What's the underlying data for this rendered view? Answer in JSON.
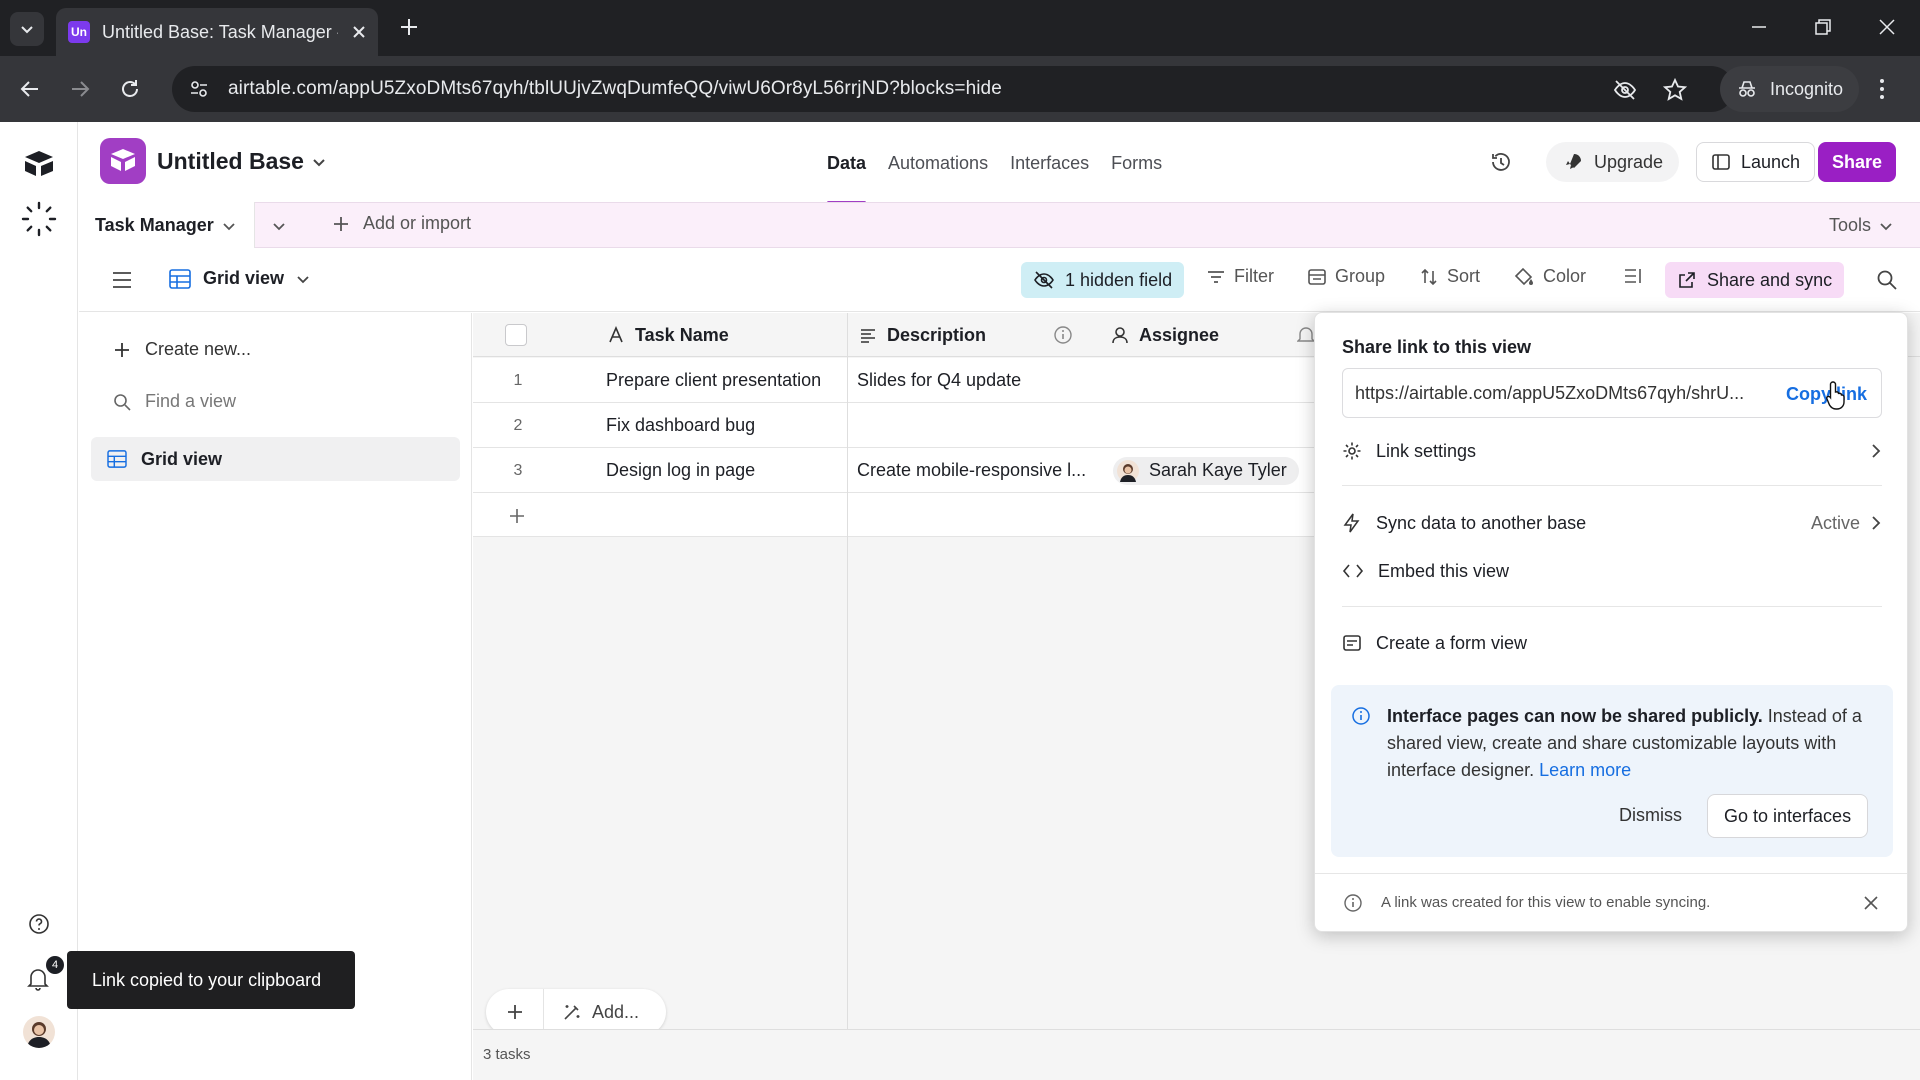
{
  "browser": {
    "tab_title": "Untitled Base: Task Manager - A",
    "tab_favicon": "Un",
    "url": "airtable.com/appU5ZxoDMts67qyh/tblUUjvZwqDumfeQQ/viwU6Or8yL56rrjND?blocks=hide",
    "incognito_label": "Incognito"
  },
  "base": {
    "title": "Untitled Base",
    "tabs": [
      "Data",
      "Automations",
      "Interfaces",
      "Forms"
    ],
    "active_tab": "Data",
    "upgrade_label": "Upgrade",
    "launch_label": "Launch",
    "share_label": "Share"
  },
  "tablebar": {
    "table_name": "Task Manager",
    "add_import": "Add or import",
    "tools": "Tools"
  },
  "viewbar": {
    "view_name": "Grid view",
    "hidden_field": "1 hidden field",
    "filter": "Filter",
    "group": "Group",
    "sort": "Sort",
    "color": "Color",
    "share_sync": "Share and sync"
  },
  "sidebar": {
    "create_new": "Create new...",
    "find_view": "Find a view",
    "views": [
      "Grid view"
    ]
  },
  "grid": {
    "columns": [
      "Task Name",
      "Description",
      "Assignee"
    ],
    "rows": [
      {
        "num": "1",
        "task": "Prepare client presentation",
        "description": "Slides for Q4 update",
        "assignee": ""
      },
      {
        "num": "2",
        "task": "Fix dashboard bug",
        "description": "",
        "assignee": ""
      },
      {
        "num": "3",
        "task": "Design log in page",
        "description": "Create mobile-responsive l...",
        "assignee": "Sarah Kaye Tyler"
      }
    ],
    "add_label": "Add...",
    "record_count": "3 tasks"
  },
  "share_popover": {
    "title": "Share link to this view",
    "link_url": "https://airtable.com/appU5ZxoDMts67qyh/shrU...",
    "copy_link": "Copy link",
    "link_settings": "Link settings",
    "sync_label": "Sync data to another base",
    "sync_status": "Active",
    "embed_label": "Embed this view",
    "form_label": "Create a form view",
    "info_bold": "Interface pages can now be shared publicly.",
    "info_body": " Instead of a shared view, create and share customizable layouts with interface designer. ",
    "learn_more": "Learn more",
    "dismiss": "Dismiss",
    "go_to_interfaces": "Go to interfaces",
    "footer_note": "A link was created for this view to enable syncing."
  },
  "toast": {
    "message": "Link copied to your clipboard"
  },
  "notifications": {
    "badge_count": "4"
  },
  "colors": {
    "brand_purple": "#9a1fc4",
    "link_blue": "#166ee1",
    "hidden_field_bg": "#cfeef5",
    "share_sync_bg": "#f7dbf6"
  }
}
